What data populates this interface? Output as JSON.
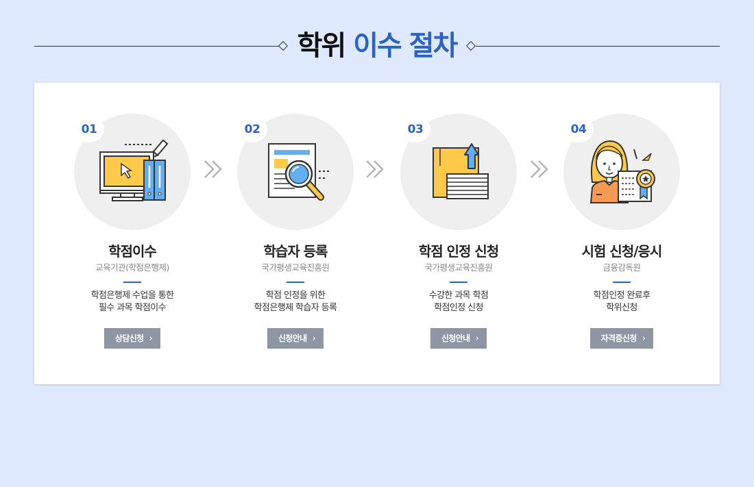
{
  "header": {
    "title_part1": "학위",
    "title_part2": "이수 절차"
  },
  "colors": {
    "background": "#dfe9fd",
    "accent": "#2a62c8",
    "button": "#8e96a3"
  },
  "steps": [
    {
      "number": "01",
      "title": "학점이수",
      "org": "교육기관(학점은행제)",
      "desc_line1": "학점은행제 수업을 통한",
      "desc_line2": "필수 과목 학점이수",
      "button_label": "상담신청",
      "icon": "computer-binder-icon"
    },
    {
      "number": "02",
      "title": "학습자 등록",
      "org": "국가평생교육진흥원",
      "desc_line1": "학점 인정을 위한",
      "desc_line2": "학점은행제 학습자 등록",
      "button_label": "신청안내",
      "icon": "document-magnifier-icon"
    },
    {
      "number": "03",
      "title": "학점 인정 신청",
      "org": "국가평생교육진흥원",
      "desc_line1": "수강한 과목 학점",
      "desc_line2": "학점인정 신청",
      "button_label": "신청안내",
      "icon": "envelope-upload-icon"
    },
    {
      "number": "04",
      "title": "시험 신청/응시",
      "org": "금융감독원",
      "desc_line1": "학점인정 완료후",
      "desc_line2": "학위신청",
      "button_label": "자격증신청",
      "icon": "person-certificate-icon"
    }
  ]
}
